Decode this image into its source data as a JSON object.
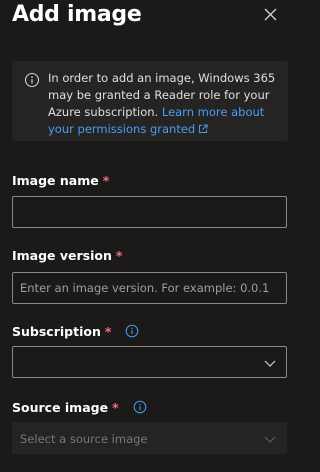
{
  "panel": {
    "title": "Add image",
    "close_icon": "close-icon"
  },
  "info": {
    "icon": "info-icon",
    "text": "In order to add an image, Windows 365 may be granted a Reader role for your Azure subscription. ",
    "link_text": "Learn more about your permissions granted",
    "link_icon": "external-link-icon"
  },
  "fields": {
    "image_name": {
      "label": "Image name",
      "required_mark": "*",
      "value": ""
    },
    "image_version": {
      "label": "Image version",
      "required_mark": "*",
      "value": "",
      "placeholder": "Enter an image version. For example: 0.0.1"
    },
    "subscription": {
      "label": "Subscription",
      "required_mark": "*",
      "info_icon": "info-icon",
      "selected": ""
    },
    "source_image": {
      "label": "Source image",
      "required_mark": "*",
      "info_icon": "info-icon",
      "placeholder": "Select a source image",
      "disabled": true
    }
  },
  "colors": {
    "background": "#1b1a19",
    "info_background": "#252423",
    "link": "#479ef5",
    "required": "#f1707b",
    "border": "#8a8886"
  }
}
